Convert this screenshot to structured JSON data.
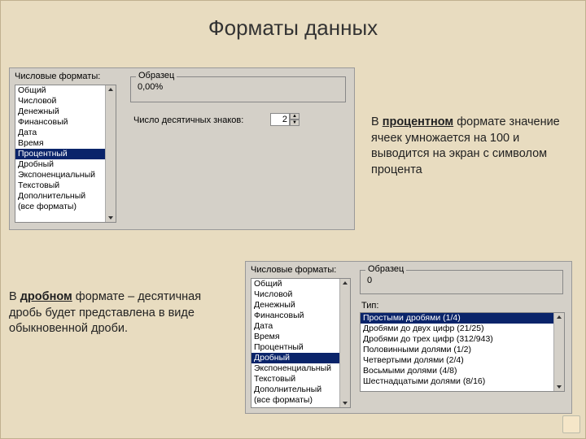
{
  "title": "Форматы данных",
  "panel1": {
    "formats_label": "Числовые форматы:",
    "formats": [
      "Общий",
      "Числовой",
      "Денежный",
      "Финансовый",
      "Дата",
      "Время",
      "Процентный",
      "Дробный",
      "Экспоненциальный",
      "Текстовый",
      "Дополнительный",
      "(все форматы)"
    ],
    "selected_index": 6,
    "sample_label": "Образец",
    "sample_value": "0,00%",
    "decimals_label": "Число десятичных знаков:",
    "decimals_value": "2"
  },
  "panel2": {
    "formats_label": "Числовые форматы:",
    "formats": [
      "Общий",
      "Числовой",
      "Денежный",
      "Финансовый",
      "Дата",
      "Время",
      "Процентный",
      "Дробный",
      "Экспоненциальный",
      "Текстовый",
      "Дополнительный",
      "(все форматы)"
    ],
    "selected_index": 7,
    "sample_label": "Образец",
    "sample_value": "0",
    "type_label": "Тип:",
    "types": [
      "Простыми дробями (1/4)",
      "Дробями до двух цифр (21/25)",
      "Дробями до трех цифр (312/943)",
      "Половинными долями (1/2)",
      "Четвертыми долями (2/4)",
      "Восьмыми долями (4/8)",
      "Шестнадцатыми долями (8/16)"
    ],
    "type_selected_index": 0
  },
  "desc1": {
    "pre": "В ",
    "key": "процентном",
    "rest": " формате значение ячеек умножается на 100 и выводится на экран с символом процента"
  },
  "desc2": {
    "pre": "В ",
    "key": "дробном",
    "rest": " формате – десятичная дробь будет представлена в виде обыкновенной дроби."
  }
}
